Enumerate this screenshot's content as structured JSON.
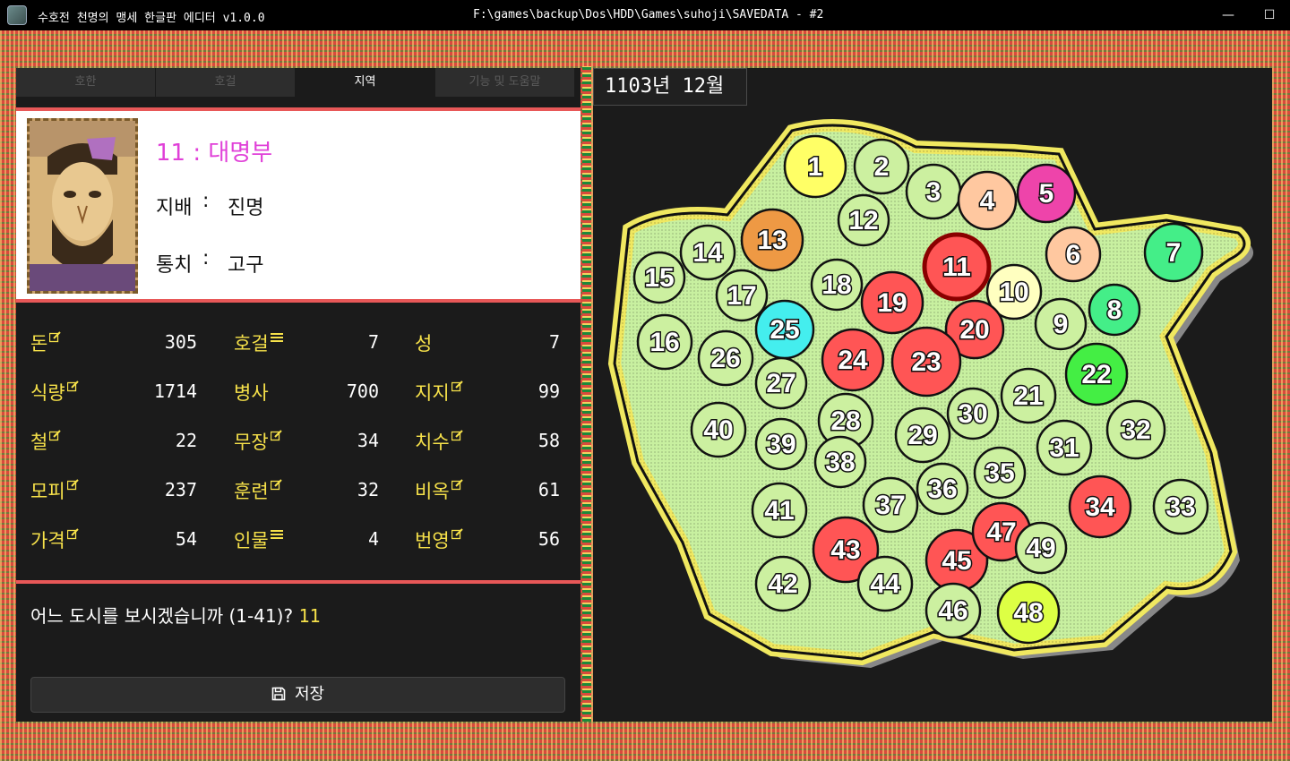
{
  "window": {
    "title": "수호전 천명의 맹세 한글판 에디터 v1.0.0",
    "path": "F:\\games\\backup\\Dos\\HDD\\Games\\suhoji\\SAVEDATA - #2",
    "minimize": "—",
    "maximize": "☐",
    "close": "✕"
  },
  "tabs": [
    {
      "label": "호한",
      "active": false
    },
    {
      "label": "호걸",
      "active": false
    },
    {
      "label": "지역",
      "active": true
    },
    {
      "label": "기능 및 도움말",
      "active": false
    }
  ],
  "city": {
    "name": "11 : 대명부",
    "ruler_label": "지배",
    "ruler": "진명",
    "governor_label": "통치",
    "governor": "고구",
    "sep": ":"
  },
  "stats": {
    "col1": [
      {
        "label": "돈",
        "value": "305",
        "icon": "edit-icon"
      },
      {
        "label": "식량",
        "value": "1714",
        "icon": "edit-icon"
      },
      {
        "label": "철",
        "value": "22",
        "icon": "edit-icon"
      },
      {
        "label": "모피",
        "value": "237",
        "icon": "edit-icon"
      },
      {
        "label": "가격",
        "value": "54",
        "icon": "edit-icon"
      }
    ],
    "col2": [
      {
        "label": "호걸",
        "value": "7",
        "icon": "list-icon"
      },
      {
        "label": "병사",
        "value": "700",
        "icon": ""
      },
      {
        "label": "무장",
        "value": "34",
        "icon": "edit-icon"
      },
      {
        "label": "훈련",
        "value": "32",
        "icon": "edit-icon"
      },
      {
        "label": "인물",
        "value": "4",
        "icon": "list-icon"
      }
    ],
    "col3": [
      {
        "label": "성",
        "value": "7",
        "icon": ""
      },
      {
        "label": "지지",
        "value": "99",
        "icon": "edit-icon"
      },
      {
        "label": "치수",
        "value": "58",
        "icon": "edit-icon"
      },
      {
        "label": "비옥",
        "value": "61",
        "icon": "edit-icon"
      },
      {
        "label": "번영",
        "value": "56",
        "icon": "edit-icon"
      }
    ]
  },
  "prompt": {
    "text": "어느 도시를 보시겠습니까 (1-41)?",
    "answer": "11"
  },
  "save_label": "저장",
  "map": {
    "date": "1103년 12월",
    "regions": [
      {
        "id": "1",
        "color": "#ffff66"
      },
      {
        "id": "2",
        "color": "#ccf0a0"
      },
      {
        "id": "3",
        "color": "#ccf0a0"
      },
      {
        "id": "4",
        "color": "#ffc8a0"
      },
      {
        "id": "5",
        "color": "#ee44aa"
      },
      {
        "id": "6",
        "color": "#ffc8a0"
      },
      {
        "id": "7",
        "color": "#44ee88"
      },
      {
        "id": "8",
        "color": "#44ee88"
      },
      {
        "id": "9",
        "color": "#ccf0a0"
      },
      {
        "id": "10",
        "color": "#ffffc0"
      },
      {
        "id": "11",
        "color": "#ff5555"
      },
      {
        "id": "12",
        "color": "#ccf0a0"
      },
      {
        "id": "13",
        "color": "#ee9944"
      },
      {
        "id": "14",
        "color": "#ccf0a0"
      },
      {
        "id": "15",
        "color": "#ccf0a0"
      },
      {
        "id": "16",
        "color": "#ccf0a0"
      },
      {
        "id": "17",
        "color": "#ccf0a0"
      },
      {
        "id": "18",
        "color": "#ccf0a0"
      },
      {
        "id": "19",
        "color": "#ff5555"
      },
      {
        "id": "20",
        "color": "#ff5555"
      },
      {
        "id": "21",
        "color": "#ccf0a0"
      },
      {
        "id": "22",
        "color": "#44ee44"
      },
      {
        "id": "23",
        "color": "#ff5555"
      },
      {
        "id": "24",
        "color": "#ff5555"
      },
      {
        "id": "25",
        "color": "#44eeee"
      },
      {
        "id": "26",
        "color": "#ccf0a0"
      },
      {
        "id": "27",
        "color": "#ccf0a0"
      },
      {
        "id": "28",
        "color": "#ccf0a0"
      },
      {
        "id": "29",
        "color": "#ccf0a0"
      },
      {
        "id": "30",
        "color": "#ccf0a0"
      },
      {
        "id": "31",
        "color": "#ccf0a0"
      },
      {
        "id": "32",
        "color": "#ccf0a0"
      },
      {
        "id": "33",
        "color": "#ccf0a0"
      },
      {
        "id": "34",
        "color": "#ff5555"
      },
      {
        "id": "35",
        "color": "#ccf0a0"
      },
      {
        "id": "36",
        "color": "#ccf0a0"
      },
      {
        "id": "37",
        "color": "#ccf0a0"
      },
      {
        "id": "38",
        "color": "#ccf0a0"
      },
      {
        "id": "39",
        "color": "#ccf0a0"
      },
      {
        "id": "40",
        "color": "#ccf0a0"
      },
      {
        "id": "41",
        "color": "#ccf0a0"
      },
      {
        "id": "42",
        "color": "#ccf0a0"
      },
      {
        "id": "43",
        "color": "#ff5555"
      },
      {
        "id": "44",
        "color": "#ccf0a0"
      },
      {
        "id": "45",
        "color": "#ff5555"
      },
      {
        "id": "46",
        "color": "#ccf0a0"
      },
      {
        "id": "47",
        "color": "#ff5555"
      },
      {
        "id": "48",
        "color": "#ddff44"
      },
      {
        "id": "49",
        "color": "#ccf0a0"
      }
    ],
    "selected": "11"
  }
}
